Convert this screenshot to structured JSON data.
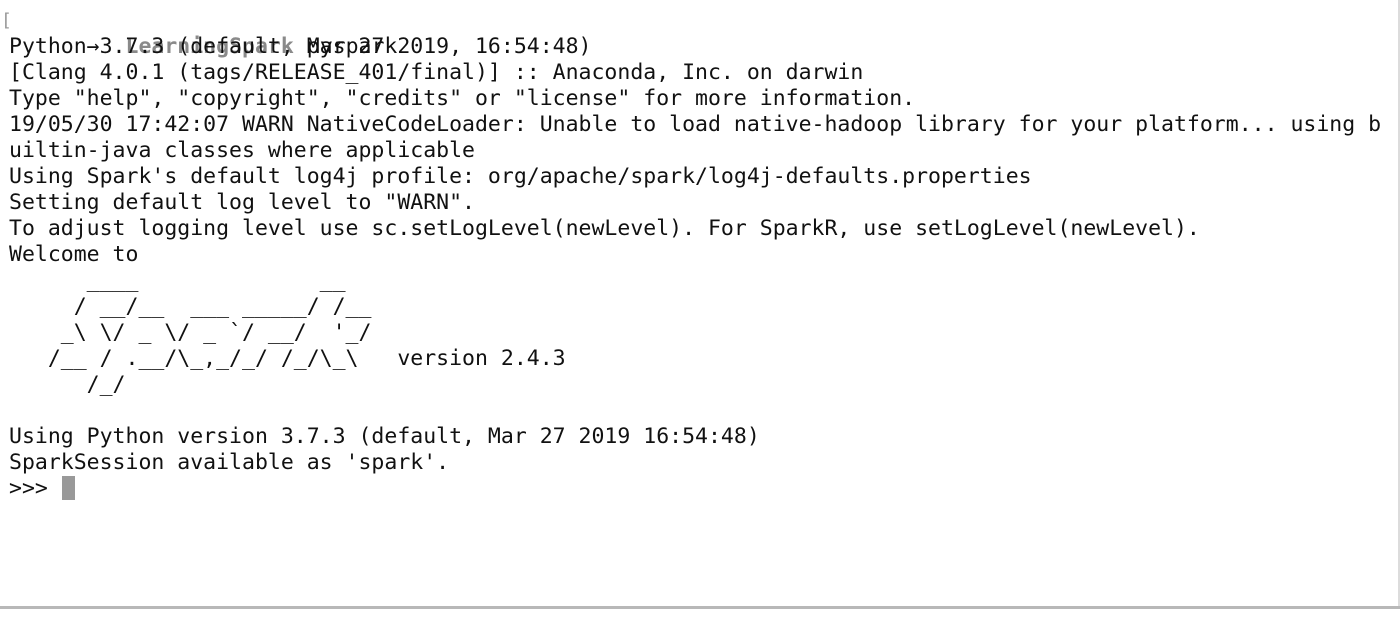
{
  "prompt": {
    "bracket": "[",
    "arrow": "→",
    "directory": "LearningSpark",
    "command": "pyspark"
  },
  "output": {
    "lines": [
      "Python 3.7.3 (default, Mar 27 2019, 16:54:48)",
      "[Clang 4.0.1 (tags/RELEASE_401/final)] :: Anaconda, Inc. on darwin",
      "Type \"help\", \"copyright\", \"credits\" or \"license\" for more information.",
      "19/05/30 17:42:07 WARN NativeCodeLoader: Unable to load native-hadoop library for your platform... using b",
      "uiltin-java classes where applicable",
      "Using Spark's default log4j profile: org/apache/spark/log4j-defaults.properties",
      "Setting default log level to \"WARN\".",
      "To adjust logging level use sc.setLogLevel(newLevel). For SparkR, use setLogLevel(newLevel).",
      "Welcome to"
    ]
  },
  "banner": {
    "ascii": [
      "      ____              __",
      "     / __/__  ___ _____/ /__",
      "    _\\ \\/ _ \\/ _ `/ __/  '_/",
      "   /__ / .__/\\_,_/_/ /_/\\_\\   version 2.4.3",
      "      /_/"
    ]
  },
  "session": {
    "python_version_line": "Using Python version 3.7.3 (default, Mar 27 2019 16:54:48)",
    "session_line": "SparkSession available as 'spark'.",
    "repl_prompt": ">>> "
  },
  "colors": {
    "background": "#ffffff",
    "text": "#111111",
    "prompt_dir": "#8a8a8a",
    "cursor": "#999999"
  }
}
